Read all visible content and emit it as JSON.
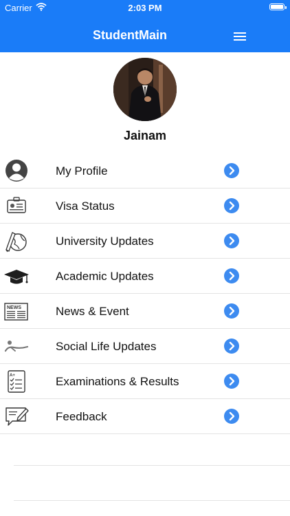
{
  "status": {
    "carrier": "Carrier",
    "time": "2:03 PM"
  },
  "header": {
    "title": "StudentMain"
  },
  "profile": {
    "name": "Jainam"
  },
  "menu": [
    {
      "label": "My Profile",
      "icon": "user-icon"
    },
    {
      "label": "Visa Status",
      "icon": "id-card-icon"
    },
    {
      "label": "University Updates",
      "icon": "globe-pen-icon"
    },
    {
      "label": "Academic Updates",
      "icon": "graduation-cap-icon"
    },
    {
      "label": "News & Event",
      "icon": "newspaper-icon"
    },
    {
      "label": "Social Life Updates",
      "icon": "social-figure-icon"
    },
    {
      "label": "Examinations & Results",
      "icon": "checklist-icon"
    },
    {
      "label": "Feedback",
      "icon": "feedback-icon"
    }
  ],
  "colors": {
    "header": "#1a7cf8",
    "arrow": "#3d8bf0"
  }
}
